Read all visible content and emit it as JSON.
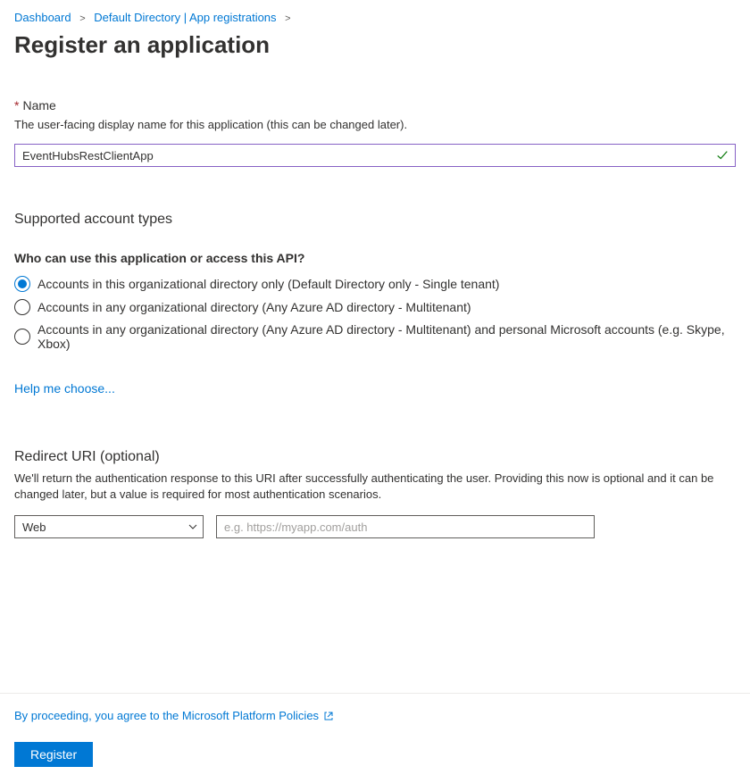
{
  "breadcrumb": {
    "items": [
      {
        "label": "Dashboard"
      },
      {
        "label": "Default Directory | App registrations"
      }
    ]
  },
  "page": {
    "title": "Register an application"
  },
  "name": {
    "label": "Name",
    "desc": "The user-facing display name for this application (this can be changed later).",
    "value": "EventHubsRestClientApp"
  },
  "accountTypes": {
    "heading": "Supported account types",
    "question": "Who can use this application or access this API?",
    "options": [
      {
        "label": "Accounts in this organizational directory only (Default Directory only - Single tenant)",
        "selected": true
      },
      {
        "label": "Accounts in any organizational directory (Any Azure AD directory - Multitenant)",
        "selected": false
      },
      {
        "label": "Accounts in any organizational directory (Any Azure AD directory - Multitenant) and personal Microsoft accounts (e.g. Skype, Xbox)",
        "selected": false
      }
    ],
    "helpLink": "Help me choose..."
  },
  "redirect": {
    "heading": "Redirect URI (optional)",
    "desc": "We'll return the authentication response to this URI after successfully authenticating the user. Providing this now is optional and it can be changed later, but a value is required for most authentication scenarios.",
    "selectValue": "Web",
    "uriPlaceholder": "e.g. https://myapp.com/auth",
    "uriValue": ""
  },
  "footer": {
    "policy": "By proceeding, you agree to the Microsoft Platform Policies",
    "registerLabel": "Register"
  }
}
